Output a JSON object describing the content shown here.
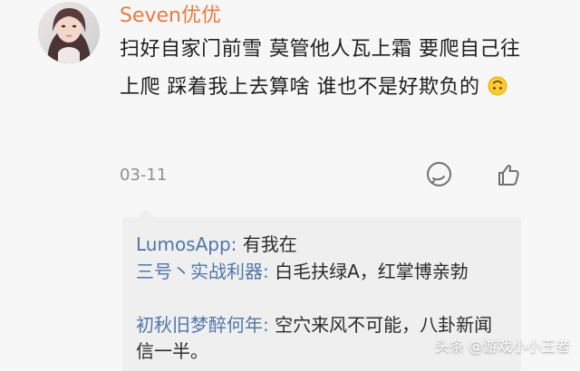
{
  "comment": {
    "username": "Seven优优",
    "text": "扫好自家门前雪 莫管他人瓦上霜 要爬自己往上爬 踩着我上去算啥 谁也不是好欺负的",
    "date": "03-11",
    "avatar": "avatar",
    "emoji": "upside-down-smile-icon",
    "reply_action": "comment-icon",
    "like_action": "thumbs-up-icon"
  },
  "replies": [
    {
      "author": "LumosApp:",
      "text": " 有我在"
    },
    {
      "author": "三号丶实战利器:",
      "text": " 白毛扶绿A，红掌博亲勃"
    },
    {
      "author": "初秋旧梦醉何年:",
      "text": " 空穴来风不可能，八卦新闻信一半。"
    }
  ],
  "watermark": "头条 @游戏小小王者",
  "colors": {
    "username": "#e97b3e",
    "reply_author": "#4f76a8",
    "background": "#f7f7f7",
    "reply_background": "#efefef"
  }
}
